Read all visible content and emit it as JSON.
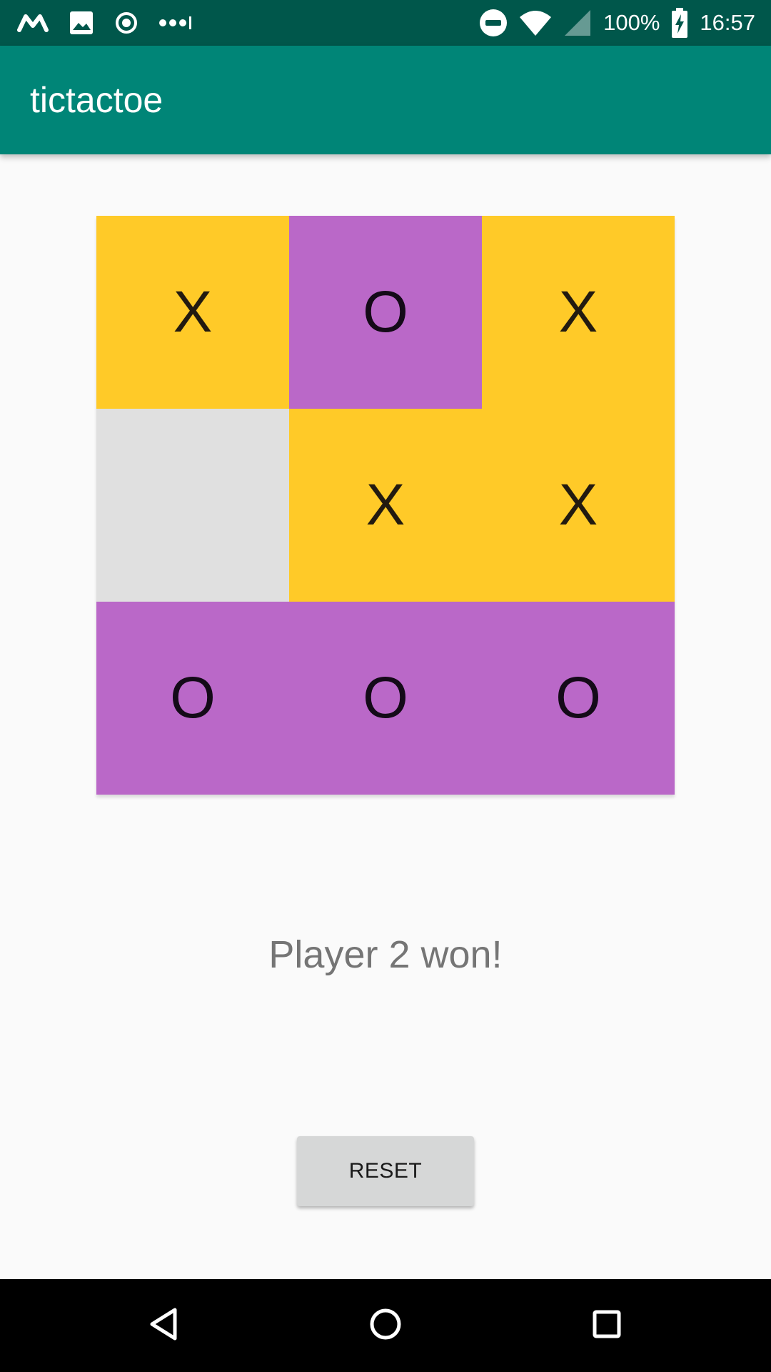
{
  "status_bar": {
    "battery_percent": "100%",
    "time": "16:57",
    "left_icons": [
      "gmail-icon",
      "image-icon",
      "record-icon",
      "more-notifications-icon"
    ],
    "right_icons": [
      "do-not-disturb-icon",
      "wifi-icon",
      "cell-signal-icon",
      "battery-charging-icon"
    ]
  },
  "app_bar": {
    "title": "tictactoe"
  },
  "board": {
    "cells": [
      {
        "value": "X",
        "state": "x"
      },
      {
        "value": "O",
        "state": "o"
      },
      {
        "value": "X",
        "state": "x"
      },
      {
        "value": "",
        "state": "empty"
      },
      {
        "value": "X",
        "state": "x"
      },
      {
        "value": "X",
        "state": "x"
      },
      {
        "value": "O",
        "state": "o"
      },
      {
        "value": "O",
        "state": "o"
      },
      {
        "value": "O",
        "state": "o"
      }
    ]
  },
  "message": "Player 2 won!",
  "reset_label": "RESET",
  "colors": {
    "status_bar": "#00574b",
    "app_bar": "#008577",
    "x_cell": "#ffca28",
    "o_cell": "#ba68c8",
    "empty_cell": "#e0e0e0"
  },
  "nav_bar": {
    "buttons": [
      "back-icon",
      "home-icon",
      "recents-icon"
    ]
  }
}
